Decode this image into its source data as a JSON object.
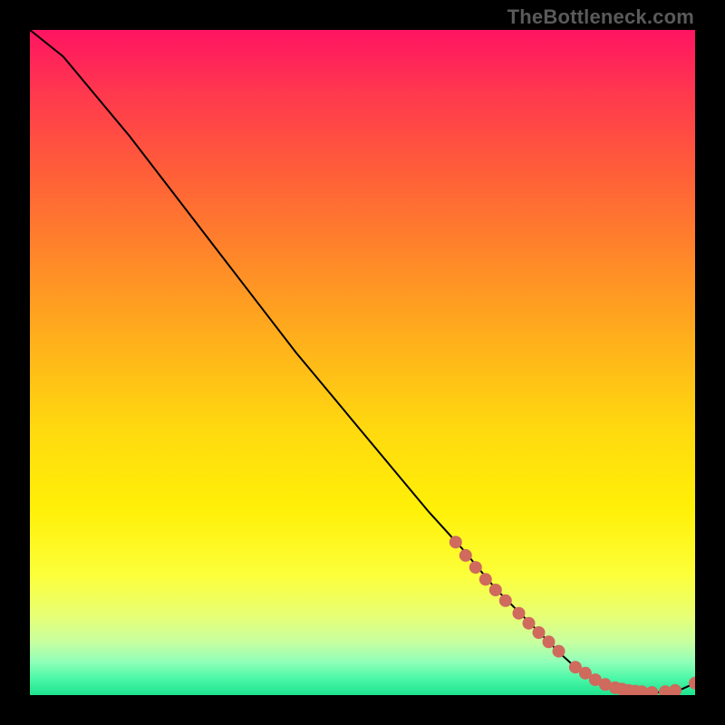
{
  "watermark": "TheBottleneck.com",
  "colors": {
    "background": "#000000",
    "curve": "#000000",
    "marker": "#cf6a5d",
    "gradient_top": "#ff1462",
    "gradient_bottom": "#1de38e"
  },
  "chart_data": {
    "type": "line",
    "title": "",
    "xlabel": "",
    "ylabel": "",
    "xlim": [
      0,
      100
    ],
    "ylim": [
      0,
      100
    ],
    "grid": false,
    "legend": false,
    "series": [
      {
        "name": "bottleneck-curve",
        "x": [
          0,
          5,
          10,
          15,
          20,
          25,
          30,
          35,
          40,
          45,
          50,
          55,
          60,
          65,
          70,
          75,
          80,
          82,
          84,
          86,
          88,
          90,
          92,
          94,
          96,
          98,
          100
        ],
        "y": [
          100,
          96,
          90,
          84,
          77.5,
          71,
          64.5,
          58,
          51.5,
          45.5,
          39.5,
          33.5,
          27.5,
          22,
          16,
          11,
          6,
          4.2,
          2.8,
          1.8,
          1.1,
          0.7,
          0.5,
          0.4,
          0.5,
          0.9,
          1.8
        ]
      }
    ],
    "markers": [
      {
        "name": "highlight-cluster",
        "points": [
          {
            "x": 64.0,
            "y": 23.0
          },
          {
            "x": 65.5,
            "y": 21.0
          },
          {
            "x": 67.0,
            "y": 19.2
          },
          {
            "x": 68.5,
            "y": 17.4
          },
          {
            "x": 70.0,
            "y": 15.8
          },
          {
            "x": 71.5,
            "y": 14.2
          },
          {
            "x": 73.5,
            "y": 12.3
          },
          {
            "x": 75.0,
            "y": 10.8
          },
          {
            "x": 76.5,
            "y": 9.4
          },
          {
            "x": 78.0,
            "y": 8.0
          },
          {
            "x": 79.5,
            "y": 6.6
          },
          {
            "x": 82.0,
            "y": 4.2
          },
          {
            "x": 83.5,
            "y": 3.3
          },
          {
            "x": 85.0,
            "y": 2.3
          },
          {
            "x": 86.5,
            "y": 1.6
          },
          {
            "x": 88.0,
            "y": 1.1
          },
          {
            "x": 89.0,
            "y": 0.9
          },
          {
            "x": 90.0,
            "y": 0.7
          },
          {
            "x": 91.0,
            "y": 0.6
          },
          {
            "x": 92.0,
            "y": 0.5
          },
          {
            "x": 93.5,
            "y": 0.4
          },
          {
            "x": 95.5,
            "y": 0.5
          },
          {
            "x": 97.0,
            "y": 0.7
          },
          {
            "x": 100.0,
            "y": 1.8
          }
        ]
      }
    ]
  }
}
